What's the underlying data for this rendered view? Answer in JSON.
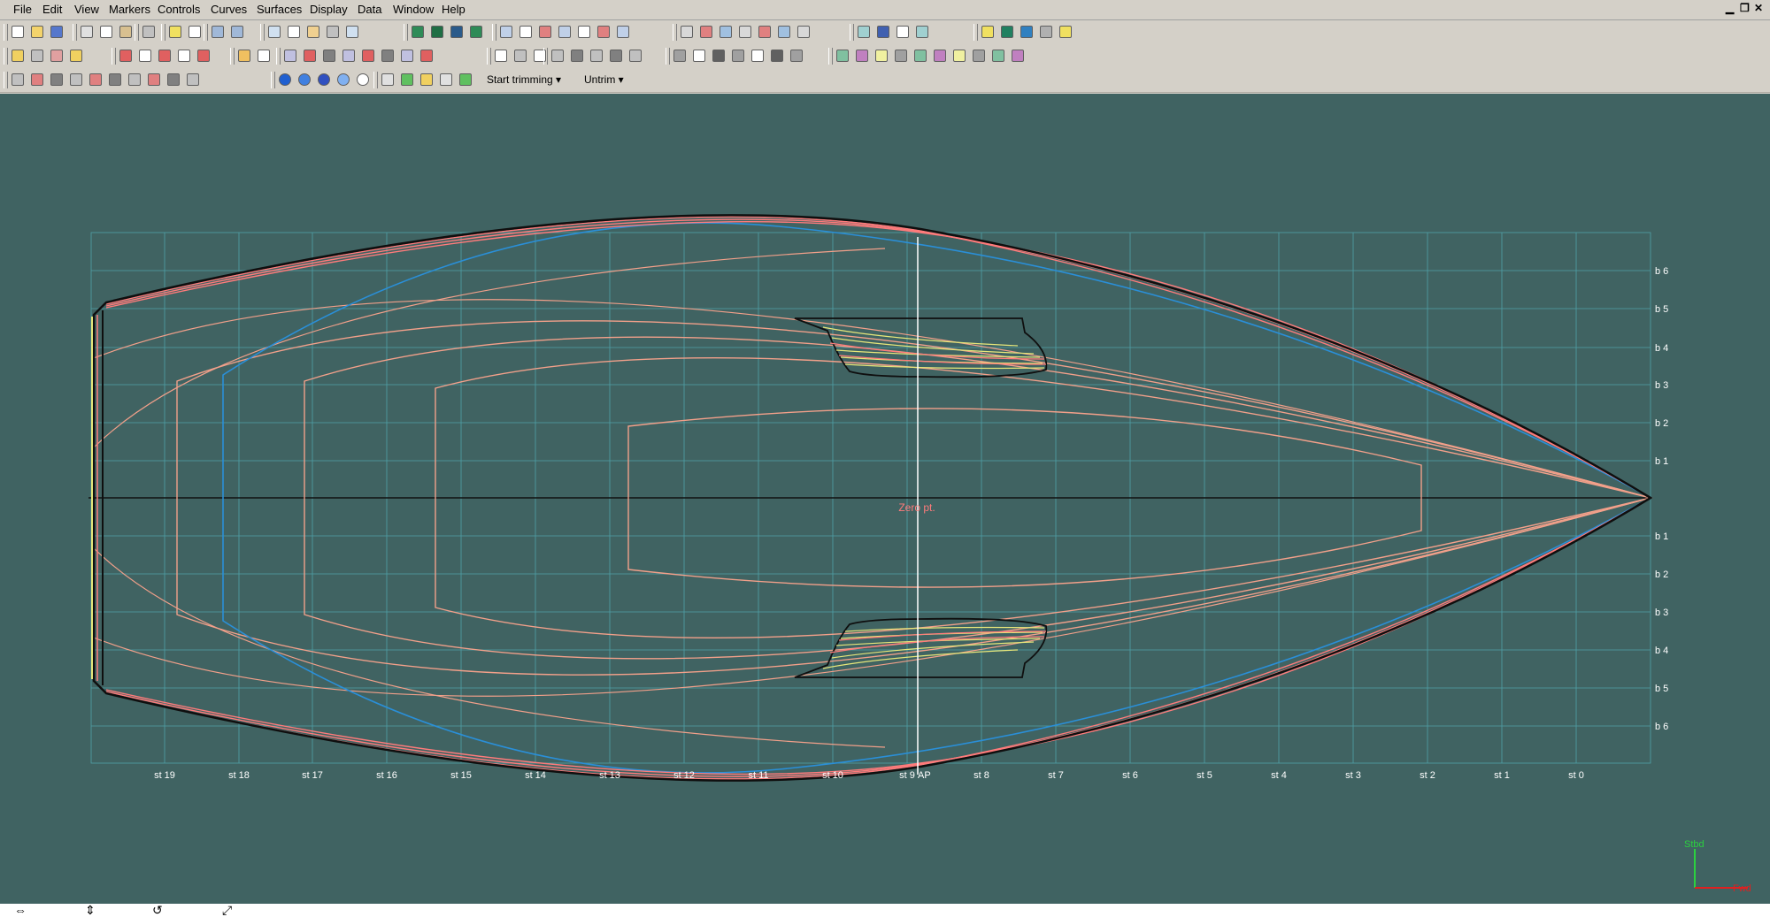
{
  "menu": [
    "File",
    "Edit",
    "View",
    "Markers",
    "Controls",
    "Curves",
    "Surfaces",
    "Display",
    "Data",
    "Window",
    "Help"
  ],
  "window_controls": {
    "minimize": "▁",
    "restore": "❐",
    "close": "✕"
  },
  "toolbar3": {
    "start_trimming": "Start trimming ▾",
    "untrim": "Untrim ▾"
  },
  "viewport": {
    "background": "#406362",
    "zero_point_label": "Zero pt.",
    "station_labels": [
      "st 19",
      "st 18",
      "st 17",
      "st 16",
      "st 15",
      "st 14",
      "st 13",
      "st 12",
      "st 11",
      "st 10",
      "st 9",
      "st 8",
      "st 7",
      "st 6",
      "st 5",
      "st 4",
      "st 3",
      "st 2",
      "st 1",
      "st 0"
    ],
    "overlap_label": "AP",
    "buttock_labels_upper": [
      "b 6",
      "b 5",
      "b 4",
      "b 3",
      "b 2",
      "b 1"
    ],
    "buttock_labels_lower": [
      "b 1",
      "b 2",
      "b 3",
      "b 4",
      "b 5",
      "b 6"
    ],
    "axis_y_label": "Stbd",
    "axis_x_label": "Fwd",
    "colors": {
      "sheer": "#ff7b7b",
      "waterline": "#f2a08a",
      "buttock_blue": "#2a8fd8",
      "hull_outline": "#0f0f0f",
      "grid": "#4fa1a8",
      "appendage_yellow": "#e6e67a"
    }
  },
  "status_icons": [
    "move-horizontal-icon",
    "move-vertical-icon",
    "rotate-icon",
    "zoom-fit-icon"
  ]
}
